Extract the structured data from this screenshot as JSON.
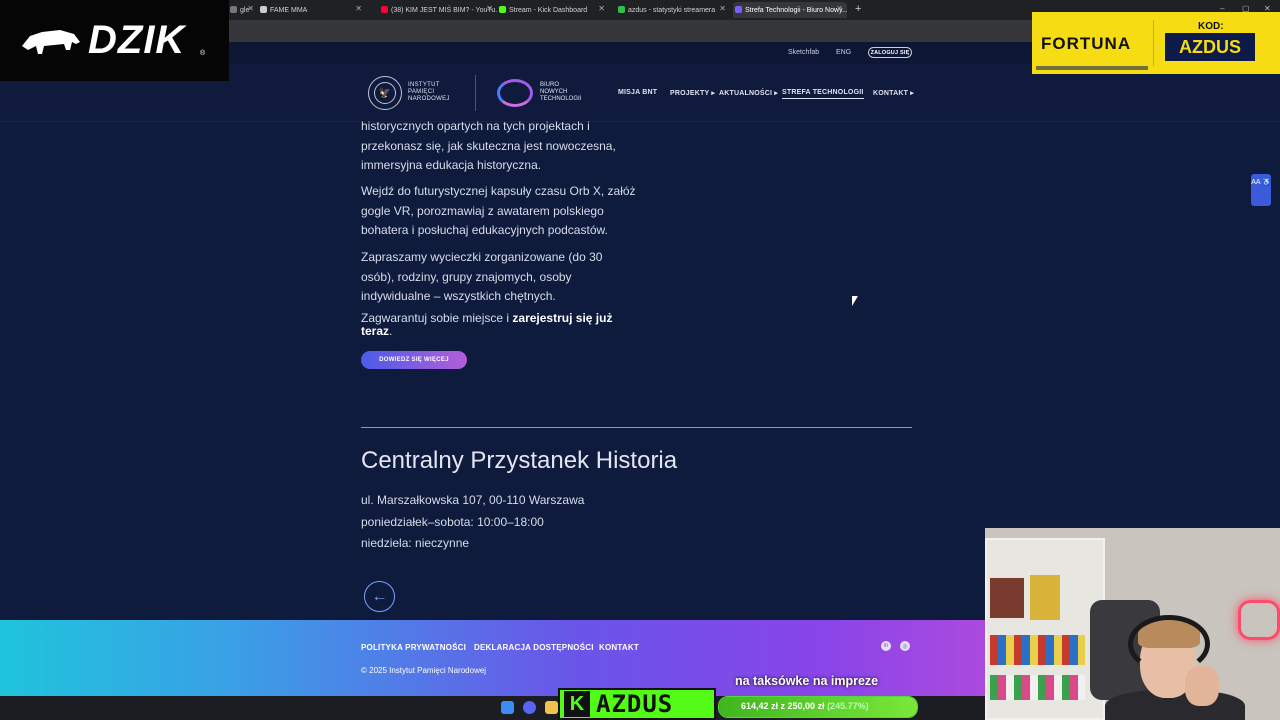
{
  "browser": {
    "tabs": [
      {
        "label": "gle",
        "favicon_color": "#777777",
        "active": false
      },
      {
        "label": "FAME MMA",
        "favicon_color": "#cccccc",
        "active": false
      },
      {
        "label": "(38) KIM JEST MIŚ BIM? - YouTu...",
        "favicon_color": "#ff0033",
        "active": false
      },
      {
        "label": "Stream - Kick Dashboard",
        "favicon_color": "#53fc18",
        "active": false
      },
      {
        "label": "azdus - statystyki streamera",
        "favicon_color": "#2fbf4a",
        "active": false
      },
      {
        "label": "Strefa Technologii - Biuro Nowy...",
        "favicon_color": "#7a5cff",
        "active": true
      }
    ],
    "new_tab": "+",
    "close": "✕",
    "window_controls": [
      "–",
      "▢",
      "✕"
    ]
  },
  "site": {
    "topbar": {
      "sketchfab": "Sketchfab",
      "lang": "ENG",
      "login": "ZALOGUJ SIĘ"
    },
    "logo_ipn": {
      "line1": "INSTYTUT",
      "line2": "PAMIĘCI",
      "line3": "NARODOWEJ",
      "emblem": "🦅"
    },
    "logo_bnt": {
      "line1": "BIURO",
      "line2": "NOWYCH",
      "line3": "TECHNOLOGII"
    },
    "nav": [
      {
        "label": "MISJA BNT",
        "active": false
      },
      {
        "label": "PROJEKTY ▸",
        "active": false
      },
      {
        "label": "AKTUALNOŚCI ▸",
        "active": false
      },
      {
        "label": "STREFA TECHNOLOGII",
        "active": true
      },
      {
        "label": "KONTAKT ▸",
        "active": false
      }
    ],
    "content": {
      "p1": "historycznych opartych na tych projektach i przekonasz się, jak skuteczna jest nowoczesna, immersyjna edukacja historyczna.",
      "p2": "Wejdź do futurystycznej kapsuły czasu Orb X, załóż gogle VR, porozmawiaj z awatarem polskiego bohatera i posłuchaj edukacyjnych podcastów.",
      "p3": "Zapraszamy wycieczki zorganizowane (do 30 osób), rodziny, grupy znajomych, osoby indywidualne – wszystkich chętnych.",
      "p4_start": "Zagwarantuj sobie miejsce i ",
      "p4_bold": "zarejestruj się już teraz",
      "p4_end": ".",
      "cta": "DOWIEDZ SIĘ WIĘCEJ",
      "stop_title": "Centralny Przystanek Historia",
      "address": "ul. Marszałkowska 107, 00-110 Warszawa",
      "hours_weekdays": "poniedziałek–sobota: 10:00–18:00",
      "hours_sunday": "niedziela: nieczynne",
      "back_arrow": "←"
    },
    "accessibility_icon": "AA ♿",
    "footer": {
      "links": [
        "POLITYKA PRYWATNOŚCI",
        "DEKLARACJA DOSTĘPNOŚCI",
        "KONTAKT"
      ],
      "copyright": "© 2025 Instytut Pamięci Narodowej",
      "social": [
        "in",
        "◎"
      ]
    }
  },
  "overlays": {
    "dzik": {
      "text": "DZIK",
      "reg": "®"
    },
    "fortuna": {
      "brand": "FORTUNA",
      "kod_label": "KOD:",
      "code": "AZDUS"
    },
    "goal": {
      "text": "na taksówke na impreze",
      "label": "614,42 zł",
      "of": " z 250,00 zł",
      "pct": " (245.77%)",
      "progress": 1.0
    },
    "kick": {
      "k": "K",
      "name": "AZDUS"
    }
  },
  "colors": {
    "page_bg": "#0f1b3d",
    "accent_gradient_start": "#4a5ce8",
    "accent_gradient_end": "#b45ed8",
    "kick_green": "#53fc18",
    "fortuna_yellow": "#f6dc12"
  }
}
